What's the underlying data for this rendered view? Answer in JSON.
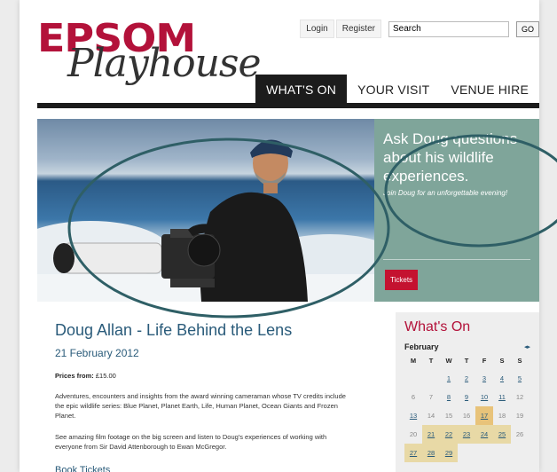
{
  "logo": {
    "line1": "EPSOM",
    "line2": "Playhouse"
  },
  "util": {
    "login": "Login",
    "register": "Register",
    "search_value": "Search",
    "go": "GO"
  },
  "nav": {
    "items": [
      "WHAT'S ON",
      "YOUR VISIT",
      "VENUE HIRE"
    ],
    "active_index": 0
  },
  "hero": {
    "heading": "Ask Doug questions about his wildlife experiences.",
    "sub": "Join Doug for an unforgettable evening!",
    "tickets": "Tickets",
    "panel_color": "#7fa59a"
  },
  "event": {
    "title": "Doug Allan - Life Behind the Lens",
    "date": "21 February 2012",
    "prices_label": "Prices from:",
    "prices_value": "£15.00",
    "para1": "Adventures, encounters and insights from the award winning cameraman whose TV credits include the epic wildlife series: Blue Planet, Planet Earth, Life, Human Planet, Ocean Giants and Frozen Planet.",
    "para2": "See amazing film footage on the big screen and listen to Doug's experiences of working with everyone from Sir David Attenborough to Ewan McGregor.",
    "book": "Book Tickets"
  },
  "sidebar": {
    "title": "What's On",
    "month": "February",
    "arrows": "◂▸",
    "dow": [
      "M",
      "T",
      "W",
      "T",
      "F",
      "S",
      "S"
    ],
    "days": [
      {
        "d": "",
        "t": "blank"
      },
      {
        "d": "",
        "t": "blank"
      },
      {
        "d": "1",
        "t": "link"
      },
      {
        "d": "2",
        "t": "link"
      },
      {
        "d": "3",
        "t": "link"
      },
      {
        "d": "4",
        "t": "link"
      },
      {
        "d": "5",
        "t": "link"
      },
      {
        "d": "6",
        "t": "plain"
      },
      {
        "d": "7",
        "t": "plain"
      },
      {
        "d": "8",
        "t": "link"
      },
      {
        "d": "9",
        "t": "link"
      },
      {
        "d": "10",
        "t": "link"
      },
      {
        "d": "11",
        "t": "link"
      },
      {
        "d": "12",
        "t": "plain"
      },
      {
        "d": "13",
        "t": "link"
      },
      {
        "d": "14",
        "t": "plain"
      },
      {
        "d": "15",
        "t": "plain"
      },
      {
        "d": "16",
        "t": "plain"
      },
      {
        "d": "17",
        "t": "today"
      },
      {
        "d": "18",
        "t": "plain"
      },
      {
        "d": "19",
        "t": "plain"
      },
      {
        "d": "20",
        "t": "plain"
      },
      {
        "d": "21",
        "t": "event"
      },
      {
        "d": "22",
        "t": "event"
      },
      {
        "d": "23",
        "t": "event"
      },
      {
        "d": "24",
        "t": "event"
      },
      {
        "d": "25",
        "t": "event"
      },
      {
        "d": "26",
        "t": "plain"
      },
      {
        "d": "27",
        "t": "event"
      },
      {
        "d": "28",
        "t": "event"
      },
      {
        "d": "29",
        "t": "event"
      }
    ]
  },
  "colors": {
    "brand": "#b3123a",
    "link": "#2a5b7a",
    "annotation": "#2f5f66"
  }
}
